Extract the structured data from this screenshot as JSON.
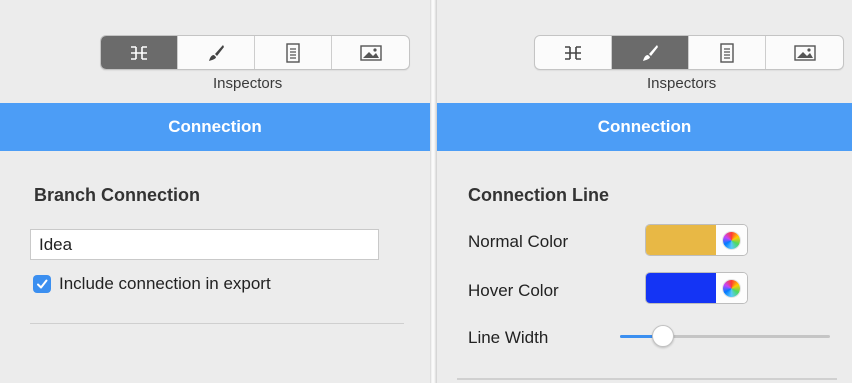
{
  "left_panel": {
    "toolbar": {
      "active_index": 0,
      "buttons": [
        {
          "icon": "mindmap-icon"
        },
        {
          "icon": "brush-icon"
        },
        {
          "icon": "document-icon"
        },
        {
          "icon": "image-icon"
        }
      ]
    },
    "inspectors_label": "Inspectors",
    "header": "Connection",
    "section_title": "Branch Connection",
    "text_field_value": "Idea",
    "checkbox": {
      "label": "Include connection in export",
      "checked": true
    }
  },
  "right_panel": {
    "toolbar": {
      "active_index": 1,
      "buttons": [
        {
          "icon": "mindmap-icon"
        },
        {
          "icon": "brush-icon"
        },
        {
          "icon": "document-icon"
        },
        {
          "icon": "image-icon"
        }
      ]
    },
    "inspectors_label": "Inspectors",
    "header": "Connection",
    "section_title": "Connection Line",
    "normal_color": {
      "label": "Normal Color",
      "color": "#e8b845"
    },
    "hover_color": {
      "label": "Hover Color",
      "color": "#1434f5"
    },
    "line_width": {
      "label": "Line Width",
      "level": 0.17
    }
  },
  "colors": {
    "accent": "#4c9df6",
    "checkbox": "#3b8ff0",
    "active_segment": "#6b6b6b"
  }
}
